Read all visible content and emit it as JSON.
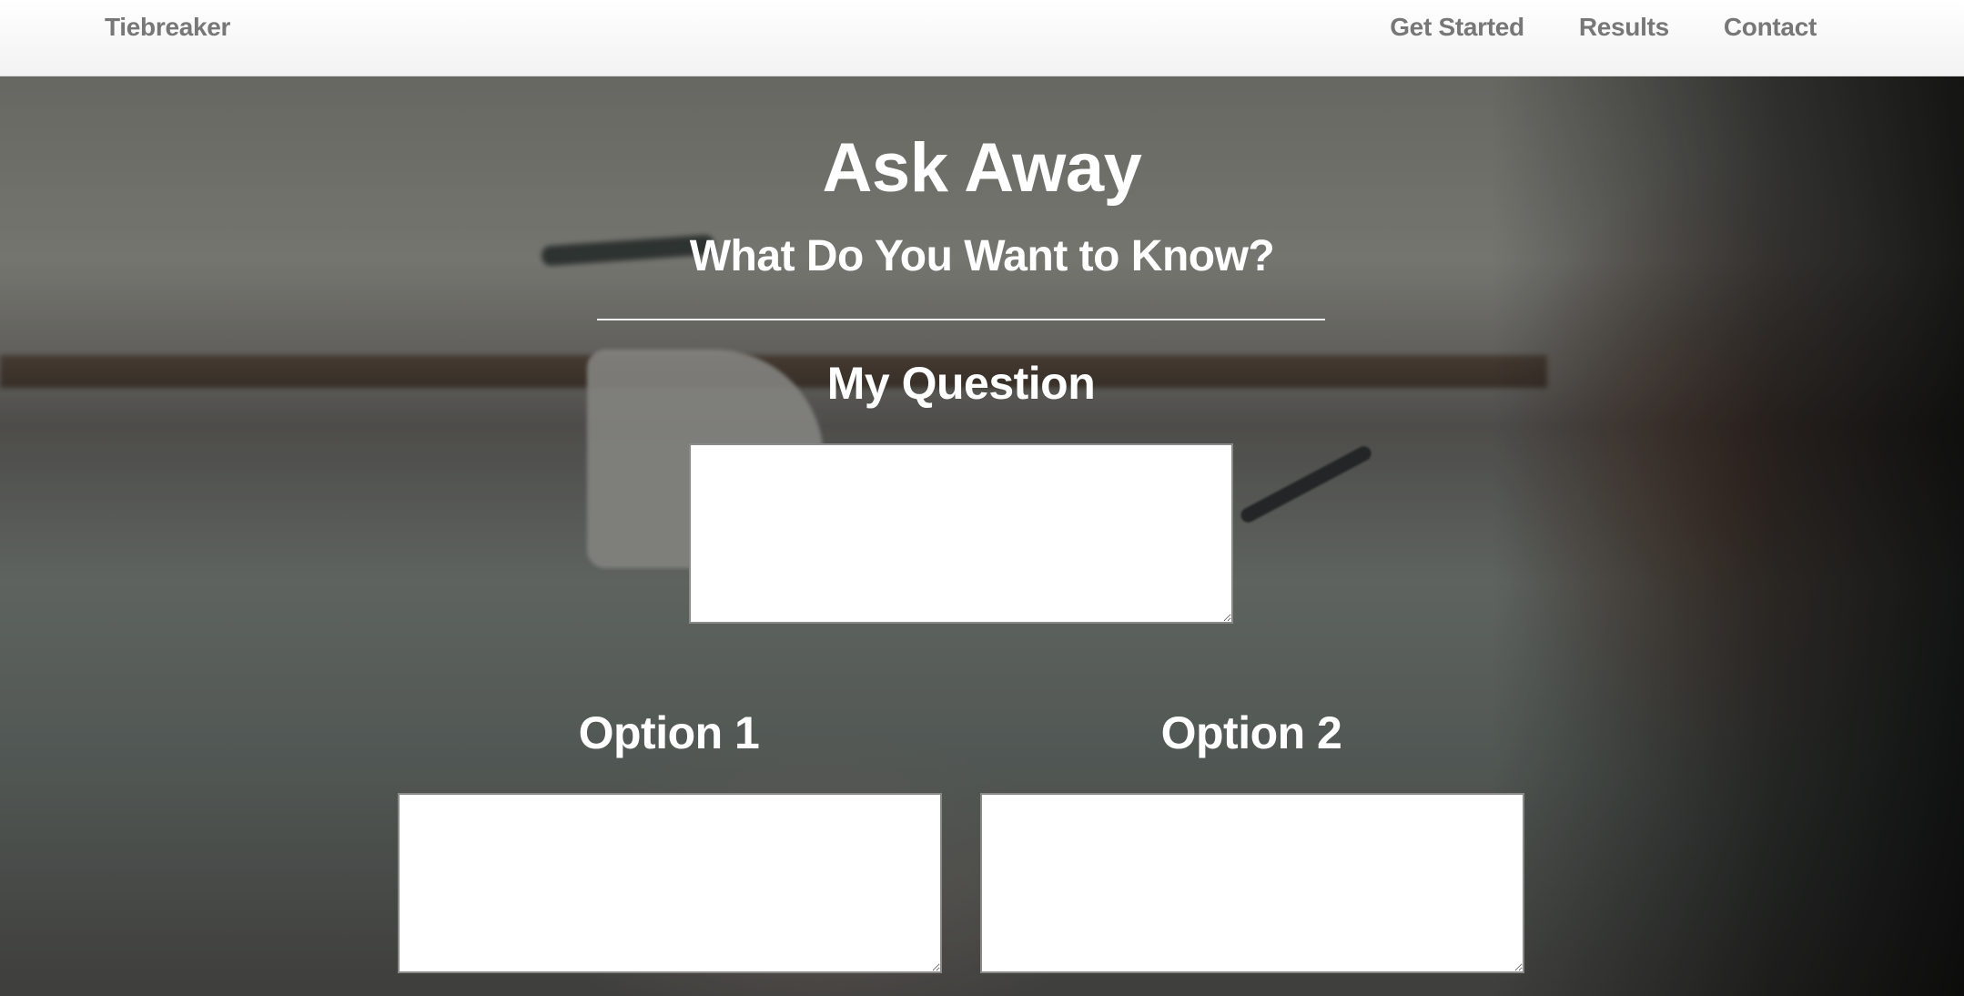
{
  "navbar": {
    "brand": "Tiebreaker",
    "links": [
      "Get Started",
      "Results",
      "Contact"
    ]
  },
  "main": {
    "title": "Ask Away",
    "subtitle": "What Do You Want to Know?",
    "question_label": "My Question",
    "question_value": "",
    "option1_label": "Option 1",
    "option1_value": "",
    "option2_label": "Option 2",
    "option2_value": ""
  },
  "colors": {
    "navbar_bg": "#f7f7f7",
    "nav_text": "#777777",
    "heading_text": "#ffffff"
  }
}
